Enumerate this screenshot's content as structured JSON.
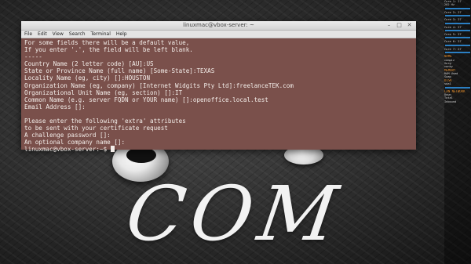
{
  "window": {
    "title": "linuxmac@vbox-server: ~",
    "controls": [
      "–",
      "□",
      "✕"
    ]
  },
  "menubar": [
    "File",
    "Edit",
    "View",
    "Search",
    "Terminal",
    "Help"
  ],
  "terminal": {
    "lines": [
      "For some fields there will be a default value,",
      "If you enter '.', the field will be left blank.",
      "-----",
      "Country Name (2 letter code) [AU]:US",
      "State or Province Name (full name) [Some-State]:TEXAS",
      "Locality Name (eg, city) []:HOUSTON",
      "Organization Name (eg, company) [Internet Widgits Pty Ltd]:freelanceTEK.com",
      "Organizational Unit Name (eg, section) []:IT",
      "Common Name (e.g. server FQDN or YOUR name) []:openoffice.local.test",
      "Email Address []:",
      "",
      "Please enter the following 'extra' attributes",
      "to be sent with your certificate request",
      "A challenge password []:",
      "An optional company name []:"
    ],
    "prompt": "linuxmac@vbox-server:~$ "
  },
  "wallpaper": {
    "text": "COM"
  },
  "conky": {
    "lines": [
      {
        "text": "Core 1: 27",
        "kind": "val"
      },
      {
        "text": "202 Hz",
        "kind": "val"
      },
      {
        "text": "Core 2: 27",
        "kind": "val"
      },
      {
        "text": "Core 3: 27",
        "kind": "val"
      },
      {
        "text": "Core 4: 27",
        "kind": "val"
      },
      {
        "text": "Core 5: 27",
        "kind": "val"
      },
      {
        "text": "Core 6: 27",
        "kind": "val"
      },
      {
        "text": "Core 7: 27",
        "kind": "val"
      },
      {
        "text": "NAME",
        "kind": "head"
      },
      {
        "text": "compiz",
        "kind": "val"
      },
      {
        "text": "Xorg",
        "kind": "val"
      },
      {
        "text": "conky",
        "kind": "val"
      },
      {
        "text": "MEMORY",
        "kind": "head"
      },
      {
        "text": "RAM Used",
        "kind": "val"
      },
      {
        "text": "Swap",
        "kind": "val"
      },
      {
        "text": "DISK",
        "kind": "head"
      },
      {
        "text": "sda1",
        "kind": "val"
      },
      {
        "text": "LAN NETWORK",
        "kind": "head"
      },
      {
        "text": "Down",
        "kind": "val"
      },
      {
        "text": "Total",
        "kind": "val"
      },
      {
        "text": "Inbound",
        "kind": "val"
      }
    ]
  }
}
